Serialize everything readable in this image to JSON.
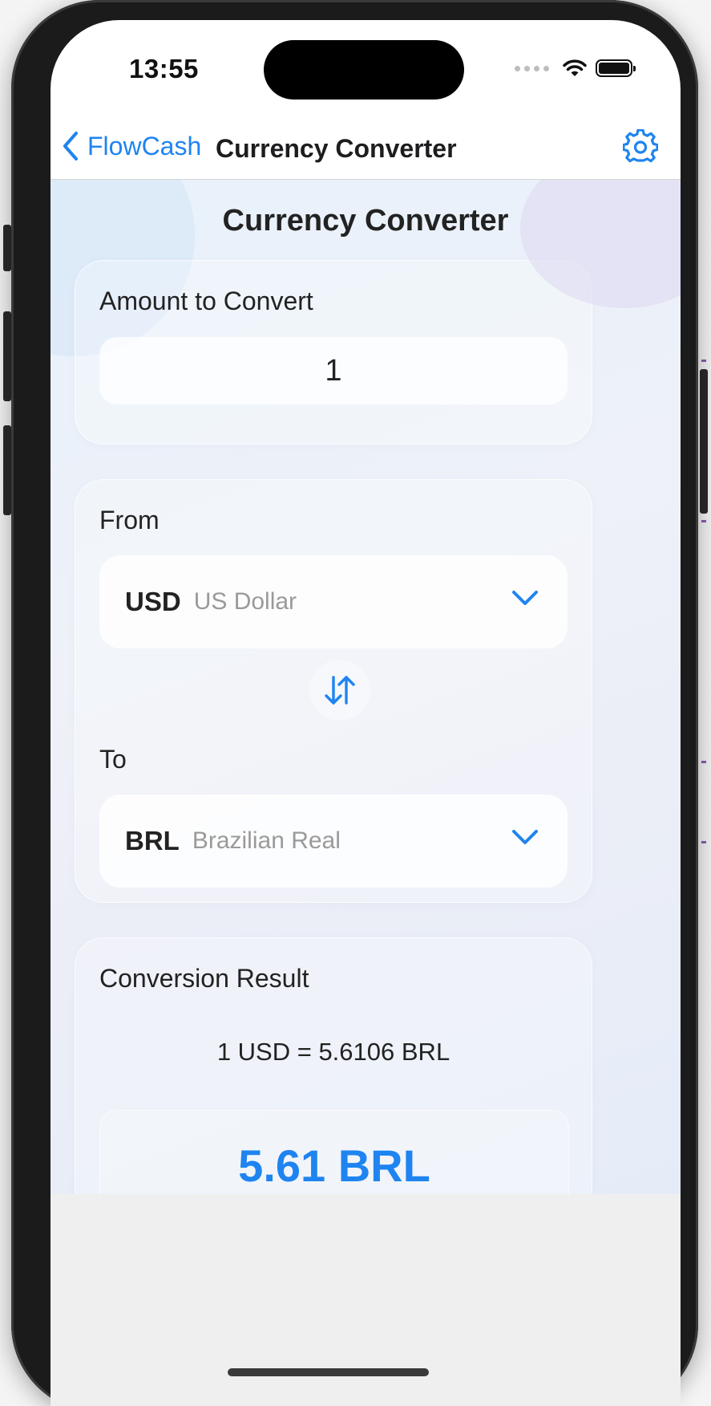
{
  "status_bar": {
    "time": "13:55"
  },
  "navbar": {
    "back_label": "FlowCash",
    "title": "Currency Converter"
  },
  "page": {
    "title": "Currency Converter"
  },
  "amount_card": {
    "label": "Amount to Convert",
    "value": "1"
  },
  "currency_card": {
    "from_label": "From",
    "from": {
      "code": "USD",
      "name": "US Dollar"
    },
    "to_label": "To",
    "to": {
      "code": "BRL",
      "name": "Brazilian Real"
    }
  },
  "result_card": {
    "label": "Conversion Result",
    "rate_text": "1 USD = 5.6106 BRL",
    "result_value": "5.61 BRL"
  },
  "colors": {
    "accent": "#1f84f0",
    "text": "#222222",
    "secondary_text": "#9a9a9a"
  },
  "icons": [
    "back-chevron-icon",
    "gear-icon",
    "chevron-down-icon",
    "swap-arrows-icon",
    "wifi-icon",
    "battery-icon"
  ]
}
